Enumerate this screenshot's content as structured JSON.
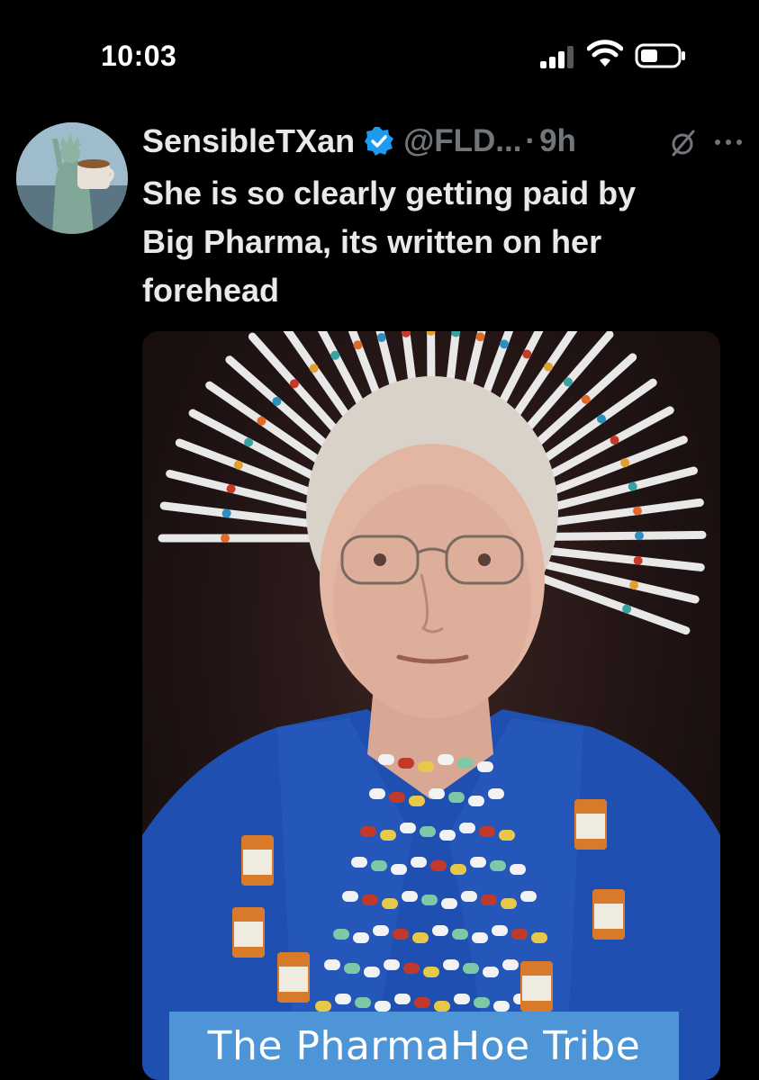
{
  "status_bar": {
    "time": "10:03",
    "icons": [
      "cellular-signal-icon",
      "wifi-icon",
      "battery-icon"
    ]
  },
  "tweet": {
    "author": {
      "display_name": "SensibleTXan",
      "verified": true,
      "handle": "@FLD...",
      "separator": "·",
      "time_ago": "9h",
      "avatar_icon": "statue-of-liberty-avatar"
    },
    "text_lines": [
      "She is so clearly getting paid by",
      "Big Pharma, its written on her",
      "forehead"
    ],
    "media": {
      "caption": "The PharmaHoe Tribe"
    }
  },
  "colors": {
    "background": "#000000",
    "text_primary": "#e7e9ea",
    "text_secondary": "#71767b",
    "verified_blue": "#1d9bf0",
    "caption_banner": "#4d95d6"
  }
}
